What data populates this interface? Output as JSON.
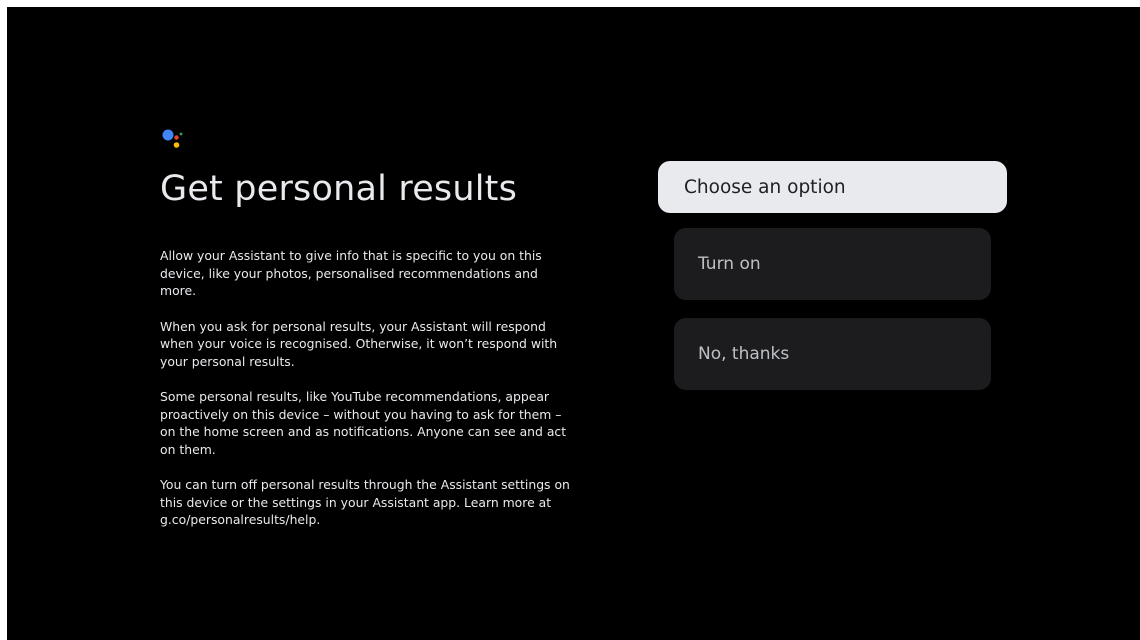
{
  "page": {
    "title": "Get personal results",
    "paragraphs": [
      "Allow your Assistant to give info that is specific to you on this device, like your photos, personalised recommendations and more.",
      "When you ask for personal results, your Assistant will respond when your voice is recognised. Otherwise, it won’t respond with your personal results.",
      "Some personal results, like YouTube recommendations, appear proactively on this device – without you having to ask for them – on the home screen and as notifications. Anyone can see and act on them.",
      "You can turn off personal results through the Assistant settings on this device or the settings in your Assistant app. Learn more at g.co/personalresults/help."
    ]
  },
  "options": {
    "header": "Choose an option",
    "turn_on": "Turn on",
    "no_thanks": "No, thanks"
  },
  "icons": {
    "logo": "google-assistant-icon"
  },
  "colors": {
    "background": "#000000",
    "text": "#e8eaed",
    "header_bg": "#e8eaed",
    "button_bg": "#1c1c1e",
    "assistant_blue": "#4285f4",
    "assistant_red": "#ea4335",
    "assistant_yellow": "#fbbc04",
    "assistant_green": "#34a853"
  }
}
